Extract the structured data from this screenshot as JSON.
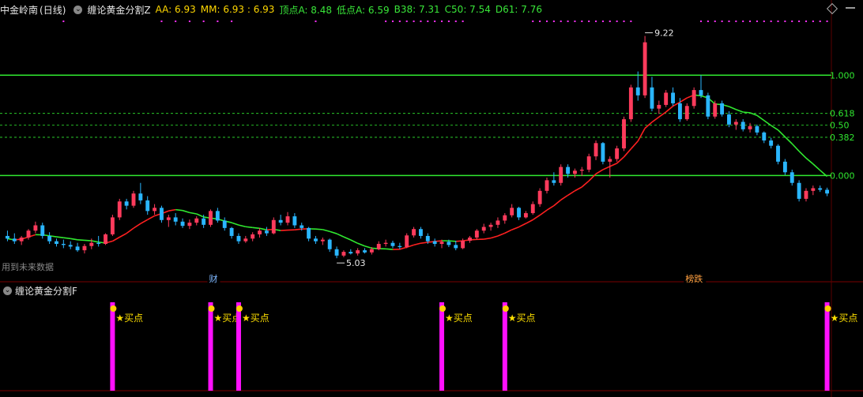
{
  "header": {
    "stock_name": "中金岭南",
    "period": "(日线)",
    "indicator_name": "缠论黄金分割Z",
    "values": [
      {
        "key": "AA",
        "text": "AA: 6.93"
      },
      {
        "key": "MM",
        "text": "MM: 6.93 : 6.93"
      },
      {
        "key": "top",
        "text": "顶点A: 8.48"
      },
      {
        "key": "low",
        "text": "低点A: 6.59"
      },
      {
        "key": "b38",
        "text": "B38: 7.31"
      },
      {
        "key": "c50",
        "text": "C50: 7.54"
      },
      {
        "key": "d61",
        "text": "D61: 7.76"
      }
    ]
  },
  "sub_panel": {
    "indicator_name": "缠论黄金分割F",
    "buy_label": "★买点"
  },
  "colors": {
    "up": "#ff3b5c",
    "down": "#2ab6ff",
    "ma_red": "#ff2020",
    "ma_green": "#30e830",
    "fib_line": "#30e830",
    "buy_bar": "#ff10ff",
    "buy_text": "#ffe000",
    "dots": "#ff30ff"
  },
  "chart_data": {
    "type": "candlestick",
    "title": "",
    "ylim": [
      4.75,
      9.6
    ],
    "fib_levels": [
      {
        "label": "1.000",
        "price": 8.48,
        "style": "solid"
      },
      {
        "label": "0.618",
        "price": 7.76,
        "style": "dashed"
      },
      {
        "label": "0.50",
        "price": 7.54,
        "style": "dashed"
      },
      {
        "label": "0.382",
        "price": 7.31,
        "style": "dashed"
      },
      {
        "label": "0.000",
        "price": 6.59,
        "style": "solid"
      }
    ],
    "annotations": [
      {
        "text": "9.22",
        "index": 91,
        "price": 9.22
      },
      {
        "text": "5.03",
        "index": 47,
        "price": 5.03
      }
    ],
    "markers": [
      {
        "text": "财",
        "index": 29
      },
      {
        "text": "榜跌",
        "index": 97
      }
    ],
    "note_text": "用到未来数据",
    "candles": [
      [
        5.45,
        5.55,
        5.35,
        5.4
      ],
      [
        5.4,
        5.5,
        5.3,
        5.35
      ],
      [
        5.35,
        5.45,
        5.28,
        5.42
      ],
      [
        5.42,
        5.58,
        5.38,
        5.55
      ],
      [
        5.55,
        5.72,
        5.5,
        5.65
      ],
      [
        5.65,
        5.7,
        5.4,
        5.45
      ],
      [
        5.45,
        5.52,
        5.3,
        5.35
      ],
      [
        5.35,
        5.4,
        5.25,
        5.3
      ],
      [
        5.3,
        5.38,
        5.22,
        5.28
      ],
      [
        5.28,
        5.35,
        5.2,
        5.25
      ],
      [
        5.25,
        5.32,
        5.15,
        5.18
      ],
      [
        5.18,
        5.3,
        5.12,
        5.26
      ],
      [
        5.26,
        5.4,
        5.2,
        5.32
      ],
      [
        5.32,
        5.45,
        5.25,
        5.3
      ],
      [
        5.3,
        5.5,
        5.28,
        5.48
      ],
      [
        5.48,
        5.85,
        5.45,
        5.8
      ],
      [
        5.8,
        6.15,
        5.75,
        6.1
      ],
      [
        6.1,
        6.15,
        5.95,
        6.02
      ],
      [
        6.02,
        6.3,
        5.98,
        6.25
      ],
      [
        6.25,
        6.45,
        6.05,
        6.12
      ],
      [
        6.12,
        6.2,
        5.85,
        5.92
      ],
      [
        5.92,
        6.05,
        5.85,
        5.98
      ],
      [
        5.98,
        6.02,
        5.7,
        5.75
      ],
      [
        5.75,
        5.85,
        5.62,
        5.8
      ],
      [
        5.8,
        5.88,
        5.65,
        5.72
      ],
      [
        5.72,
        5.78,
        5.6,
        5.64
      ],
      [
        5.64,
        5.76,
        5.58,
        5.7
      ],
      [
        5.7,
        5.82,
        5.65,
        5.78
      ],
      [
        5.78,
        5.85,
        5.6,
        5.66
      ],
      [
        5.66,
        5.95,
        5.62,
        5.92
      ],
      [
        5.92,
        5.98,
        5.7,
        5.74
      ],
      [
        5.74,
        5.8,
        5.55,
        5.6
      ],
      [
        5.6,
        5.62,
        5.4,
        5.45
      ],
      [
        5.45,
        5.5,
        5.3,
        5.35
      ],
      [
        5.35,
        5.45,
        5.32,
        5.4
      ],
      [
        5.4,
        5.52,
        5.35,
        5.48
      ],
      [
        5.48,
        5.6,
        5.42,
        5.55
      ],
      [
        5.55,
        5.62,
        5.45,
        5.5
      ],
      [
        5.5,
        5.8,
        5.48,
        5.75
      ],
      [
        5.75,
        5.85,
        5.65,
        5.7
      ],
      [
        5.7,
        5.9,
        5.65,
        5.82
      ],
      [
        5.82,
        5.88,
        5.6,
        5.65
      ],
      [
        5.65,
        5.7,
        5.55,
        5.6
      ],
      [
        5.6,
        5.62,
        5.35,
        5.4
      ],
      [
        5.4,
        5.45,
        5.3,
        5.35
      ],
      [
        5.35,
        5.42,
        5.28,
        5.38
      ],
      [
        5.38,
        5.4,
        5.15,
        5.2
      ],
      [
        5.2,
        5.25,
        5.03,
        5.08
      ],
      [
        5.08,
        5.18,
        5.05,
        5.15
      ],
      [
        5.15,
        5.2,
        5.1,
        5.12
      ],
      [
        5.12,
        5.22,
        5.08,
        5.18
      ],
      [
        5.18,
        5.22,
        5.12,
        5.14
      ],
      [
        5.14,
        5.24,
        5.1,
        5.2
      ],
      [
        5.2,
        5.35,
        5.18,
        5.3
      ],
      [
        5.3,
        5.38,
        5.25,
        5.32
      ],
      [
        5.32,
        5.36,
        5.22,
        5.26
      ],
      [
        5.26,
        5.32,
        5.2,
        5.24
      ],
      [
        5.24,
        5.5,
        5.22,
        5.46
      ],
      [
        5.46,
        5.62,
        5.42,
        5.58
      ],
      [
        5.58,
        5.62,
        5.4,
        5.45
      ],
      [
        5.45,
        5.5,
        5.3,
        5.35
      ],
      [
        5.35,
        5.4,
        5.25,
        5.3
      ],
      [
        5.3,
        5.38,
        5.22,
        5.34
      ],
      [
        5.34,
        5.38,
        5.24,
        5.28
      ],
      [
        5.28,
        5.36,
        5.18,
        5.22
      ],
      [
        5.22,
        5.4,
        5.2,
        5.36
      ],
      [
        5.36,
        5.45,
        5.32,
        5.42
      ],
      [
        5.42,
        5.58,
        5.38,
        5.55
      ],
      [
        5.55,
        5.68,
        5.5,
        5.62
      ],
      [
        5.62,
        5.7,
        5.55,
        5.66
      ],
      [
        5.66,
        5.8,
        5.6,
        5.74
      ],
      [
        5.74,
        5.88,
        5.68,
        5.84
      ],
      [
        5.84,
        6.05,
        5.8,
        5.98
      ],
      [
        5.98,
        6.0,
        5.75,
        5.8
      ],
      [
        5.8,
        5.92,
        5.78,
        5.88
      ],
      [
        5.88,
        6.1,
        5.85,
        6.05
      ],
      [
        6.05,
        6.35,
        6.0,
        6.3
      ],
      [
        6.3,
        6.55,
        6.25,
        6.5
      ],
      [
        6.5,
        6.65,
        6.4,
        6.45
      ],
      [
        6.45,
        6.8,
        6.4,
        6.75
      ],
      [
        6.75,
        6.8,
        6.55,
        6.62
      ],
      [
        6.62,
        6.72,
        6.55,
        6.68
      ],
      [
        6.68,
        6.75,
        6.58,
        6.7
      ],
      [
        6.7,
        7.0,
        6.65,
        6.95
      ],
      [
        6.95,
        7.25,
        6.88,
        7.2
      ],
      [
        7.2,
        7.22,
        6.8,
        6.85
      ],
      [
        6.85,
        6.95,
        6.55,
        6.9
      ],
      [
        6.9,
        7.15,
        6.85,
        7.1
      ],
      [
        7.1,
        7.7,
        7.05,
        7.65
      ],
      [
        7.65,
        8.3,
        7.6,
        8.25
      ],
      [
        8.25,
        8.55,
        8.0,
        8.1
      ],
      [
        8.1,
        9.22,
        8.05,
        9.1
      ],
      [
        8.25,
        8.45,
        7.8,
        7.85
      ],
      [
        7.85,
        8.0,
        7.75,
        7.92
      ],
      [
        7.92,
        8.2,
        7.88,
        8.15
      ],
      [
        8.15,
        8.25,
        7.9,
        7.95
      ],
      [
        7.95,
        8.05,
        7.6,
        7.65
      ],
      [
        7.65,
        7.95,
        7.62,
        7.9
      ],
      [
        7.9,
        8.25,
        7.85,
        8.2
      ],
      [
        8.2,
        8.48,
        8.05,
        8.1
      ],
      [
        8.1,
        8.15,
        7.65,
        7.7
      ],
      [
        7.7,
        8.0,
        7.66,
        7.95
      ],
      [
        7.95,
        8.0,
        7.7,
        7.74
      ],
      [
        7.74,
        7.8,
        7.5,
        7.55
      ],
      [
        7.55,
        7.65,
        7.45,
        7.6
      ],
      [
        7.6,
        7.65,
        7.42,
        7.46
      ],
      [
        7.46,
        7.58,
        7.4,
        7.52
      ],
      [
        7.52,
        7.55,
        7.35,
        7.4
      ],
      [
        7.4,
        7.42,
        7.2,
        7.25
      ],
      [
        7.25,
        7.3,
        7.1,
        7.15
      ],
      [
        7.15,
        7.18,
        6.8,
        6.85
      ],
      [
        6.85,
        6.9,
        6.6,
        6.65
      ],
      [
        6.65,
        6.7,
        6.4,
        6.45
      ],
      [
        6.45,
        6.5,
        6.1,
        6.15
      ],
      [
        6.15,
        6.35,
        6.1,
        6.3
      ],
      [
        6.3,
        6.4,
        6.22,
        6.35
      ],
      [
        6.35,
        6.4,
        6.28,
        6.32
      ],
      [
        6.32,
        6.36,
        6.2,
        6.25
      ]
    ],
    "buy_signals": [
      15,
      29,
      33,
      62,
      71,
      117
    ]
  }
}
